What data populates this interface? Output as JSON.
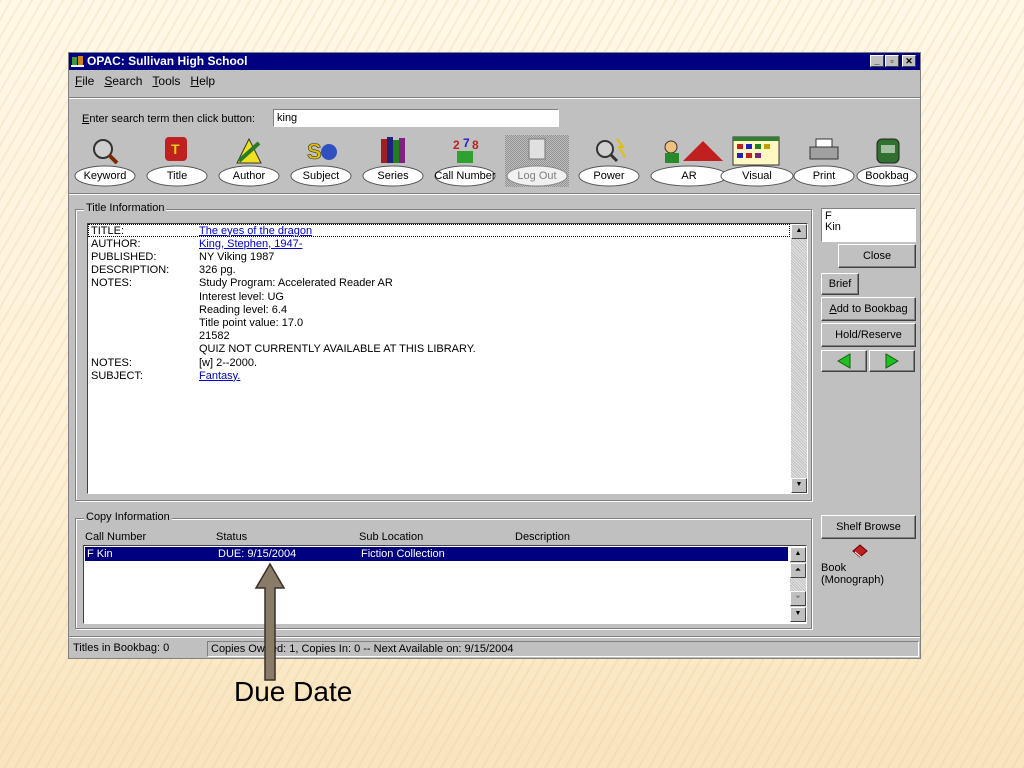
{
  "window": {
    "title": "OPAC: Sullivan High School"
  },
  "menu": {
    "file": "File",
    "file_u": "F",
    "search": "Search",
    "search_u": "S",
    "tools": "Tools",
    "tools_u": "T",
    "help": "Help",
    "help_u": "H"
  },
  "search": {
    "label": "Enter search term then click button:",
    "label_u": "E",
    "value": "king"
  },
  "toolbar": [
    "Keyword",
    "Title",
    "Author",
    "Subject",
    "Series",
    "Call Number",
    "Log Out",
    "Power",
    "AR",
    "Visual",
    "Print",
    "Bookbag"
  ],
  "title_info": {
    "group_label": "Title Information",
    "rows": [
      {
        "k": "TITLE:",
        "v": "The eyes of the dragon",
        "link": true
      },
      {
        "k": "AUTHOR:",
        "v": "King, Stephen, 1947-",
        "link": true
      },
      {
        "k": "PUBLISHED:",
        "v": "NY Viking 1987"
      },
      {
        "k": "DESCRIPTION:",
        "v": "326 pg."
      },
      {
        "k": "NOTES:",
        "v": "Study Program: Accelerated Reader AR"
      },
      {
        "k": "",
        "v": "Interest level: UG"
      },
      {
        "k": "",
        "v": "Reading level: 6.4"
      },
      {
        "k": "",
        "v": "Title point value: 17.0"
      },
      {
        "k": "",
        "v": "21582"
      },
      {
        "k": "",
        "v": "QUIZ NOT CURRENTLY AVAILABLE AT THIS LIBRARY."
      },
      {
        "k": "NOTES:",
        "v": "[w] 2--2000."
      },
      {
        "k": "SUBJECT:",
        "v": "Fantasy.",
        "link": true
      }
    ]
  },
  "side": {
    "call_line1": "F",
    "call_line2": "Kin",
    "close": "Close",
    "brief": "Brief",
    "add_bookbag": "Add to Bookbag",
    "add_u": "A",
    "hold_reserve": "Hold/Reserve",
    "shelf_browse": "Shelf Browse",
    "material_line1": "Book",
    "material_line2": "(Monograph)"
  },
  "copy_info": {
    "group_label": "Copy Information",
    "headers": [
      "Call Number",
      "Status",
      "Sub Location",
      "Description"
    ],
    "rows": [
      {
        "call": "F Kin",
        "status": "DUE: 9/15/2004",
        "location": "Fiction Collection",
        "description": ""
      }
    ]
  },
  "status": {
    "bookbag": "Titles in Bookbag:  0",
    "copies": "Copies Owned:  1, Copies In:  0 -- Next Available on: 9/15/2004"
  },
  "annotation": {
    "label": "Due Date"
  },
  "colors": {
    "title_bar": "#000080",
    "selection": "#000080",
    "link": "#0000cc",
    "window_face": "#c0c0c0"
  }
}
